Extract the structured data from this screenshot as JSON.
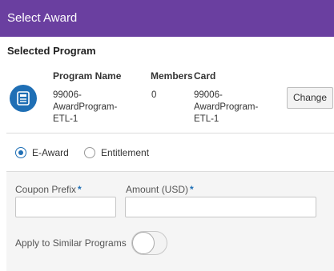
{
  "dialog": {
    "title": "Select Award"
  },
  "selected_program": {
    "heading": "Selected Program",
    "columns": {
      "program_name": "Program Name",
      "members": "Members",
      "card": "Card"
    },
    "row": {
      "program_name": [
        "99006-",
        "AwardProgram-",
        "ETL-1"
      ],
      "members": "0",
      "card": [
        "99006-",
        "AwardProgram-",
        "ETL-1"
      ]
    },
    "change_label": "Change",
    "icon": "program-card-icon"
  },
  "award_type": {
    "options": [
      "E-Award",
      "Entitlement"
    ],
    "selected": "E-Award"
  },
  "form": {
    "coupon_prefix_label": "Coupon Prefix",
    "amount_label": "Amount (USD)",
    "required_marker": "*",
    "coupon_prefix_value": "",
    "amount_value": "",
    "apply_similar_label": "Apply to Similar Programs",
    "apply_similar_on": false
  },
  "colors": {
    "title_bar": "#6a3fa0",
    "accent": "#1f6fb5"
  }
}
